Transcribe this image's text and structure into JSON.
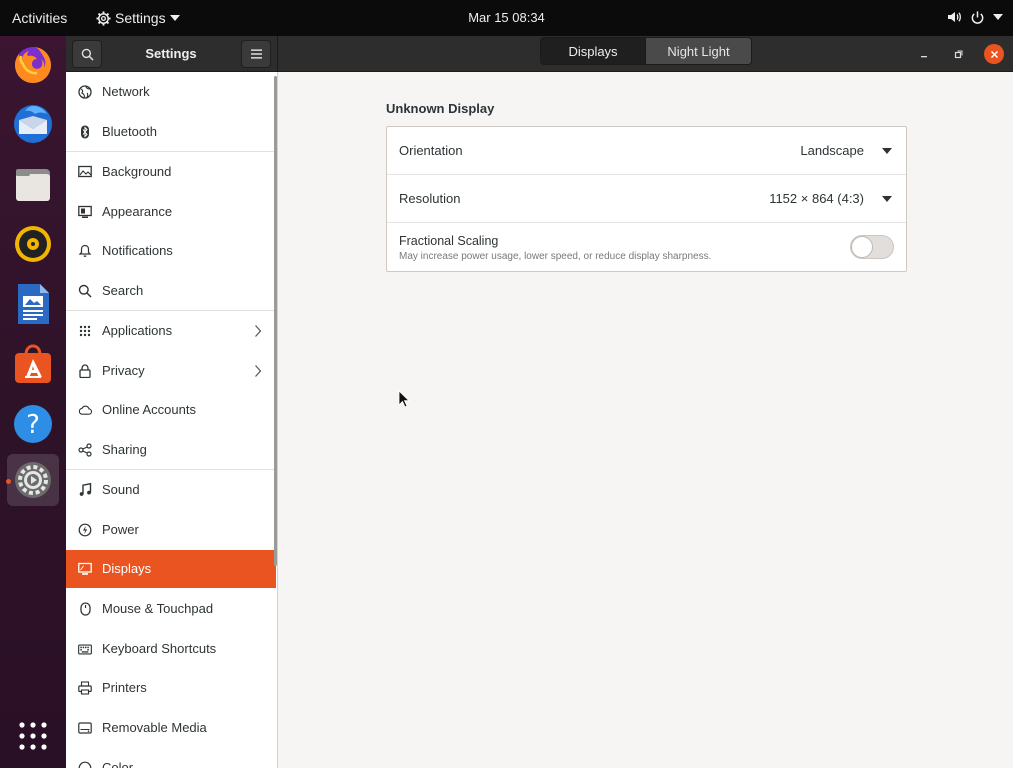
{
  "topbar": {
    "activities": "Activities",
    "app_menu": "Settings",
    "clock": "Mar 15  08:34"
  },
  "dock": {
    "items": [
      {
        "name": "firefox-icon"
      },
      {
        "name": "thunderbird-icon"
      },
      {
        "name": "files-icon"
      },
      {
        "name": "rhythmbox-icon"
      },
      {
        "name": "libreoffice-writer-icon"
      },
      {
        "name": "ubuntu-software-icon"
      },
      {
        "name": "help-icon"
      },
      {
        "name": "settings-icon",
        "active": true
      },
      {
        "name": "show-applications-icon"
      }
    ]
  },
  "headerbar": {
    "title": "Settings",
    "tabs": [
      {
        "label": "Displays",
        "active": true
      },
      {
        "label": "Night Light",
        "active": false
      }
    ]
  },
  "sidebar": {
    "items": [
      {
        "label": "Network",
        "icon": "network-icon"
      },
      {
        "label": "Bluetooth",
        "icon": "bluetooth-icon"
      },
      {
        "label": "Background",
        "icon": "background-icon"
      },
      {
        "label": "Appearance",
        "icon": "appearance-icon"
      },
      {
        "label": "Notifications",
        "icon": "notifications-icon"
      },
      {
        "label": "Search",
        "icon": "search-icon"
      },
      {
        "label": "Applications",
        "icon": "applications-icon",
        "chevron": true
      },
      {
        "label": "Privacy",
        "icon": "privacy-icon",
        "chevron": true
      },
      {
        "label": "Online Accounts",
        "icon": "online-accounts-icon"
      },
      {
        "label": "Sharing",
        "icon": "sharing-icon"
      },
      {
        "label": "Sound",
        "icon": "sound-icon"
      },
      {
        "label": "Power",
        "icon": "power-icon"
      },
      {
        "label": "Displays",
        "icon": "displays-icon",
        "selected": true
      },
      {
        "label": "Mouse & Touchpad",
        "icon": "mouse-icon"
      },
      {
        "label": "Keyboard Shortcuts",
        "icon": "keyboard-icon"
      },
      {
        "label": "Printers",
        "icon": "printers-icon"
      },
      {
        "label": "Removable Media",
        "icon": "removable-media-icon"
      },
      {
        "label": "Color",
        "icon": "color-icon"
      }
    ]
  },
  "display": {
    "section_title": "Unknown Display",
    "orientation_label": "Orientation",
    "orientation_value": "Landscape",
    "resolution_label": "Resolution",
    "resolution_value": "1152 × 864 (4:3)",
    "scaling_label": "Fractional Scaling",
    "scaling_desc": "May increase power usage, lower speed, or reduce display sharpness.",
    "scaling_enabled": false
  },
  "colors": {
    "accent": "#e95420",
    "dock_bg": "#2e1228",
    "topbar_bg": "#0b0b0b"
  }
}
